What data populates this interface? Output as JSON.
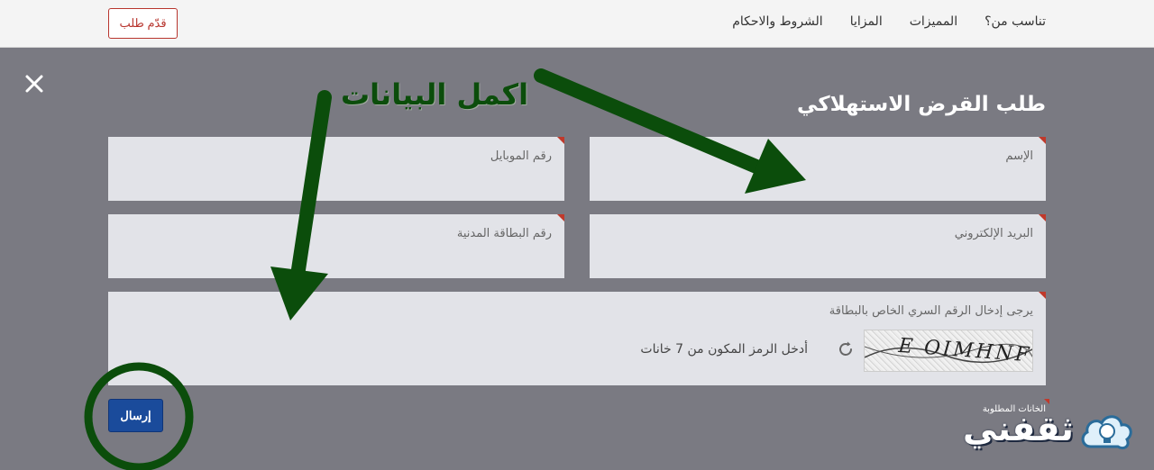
{
  "nav": {
    "links": [
      {
        "label": "تناسب من؟"
      },
      {
        "label": "المميزات"
      },
      {
        "label": "المزايا"
      },
      {
        "label": "الشروط والاحكام"
      }
    ],
    "apply_label": "قدّم طلب"
  },
  "form": {
    "title": "طلب القرض الاستهلاكي",
    "fields": {
      "name": "الإسم",
      "mobile": "رقم الموبايل",
      "email": "البريد الإلكتروني",
      "civil_id": "رقم البطاقة المدنية"
    },
    "captcha_instruction": "يرجى إدخال الرقم السري الخاص بالبطاقة",
    "captcha_text": "E OIMHNF",
    "captcha_placeholder": "أدخل الرمز المكون من 7 خانات",
    "required_note": "الخانات المطلوبة",
    "submit_label": "إرسال"
  },
  "annotation": {
    "text": "اكمل البيانات",
    "color": "#0b4d0b"
  },
  "brand": {
    "name": "ثقفني"
  },
  "colors": {
    "overlay": "#7a7a82",
    "field_bg": "#e2e3e8",
    "required_marker": "#c0392b",
    "submit_bg": "#1a4b9b",
    "apply_border": "#b8352e"
  }
}
